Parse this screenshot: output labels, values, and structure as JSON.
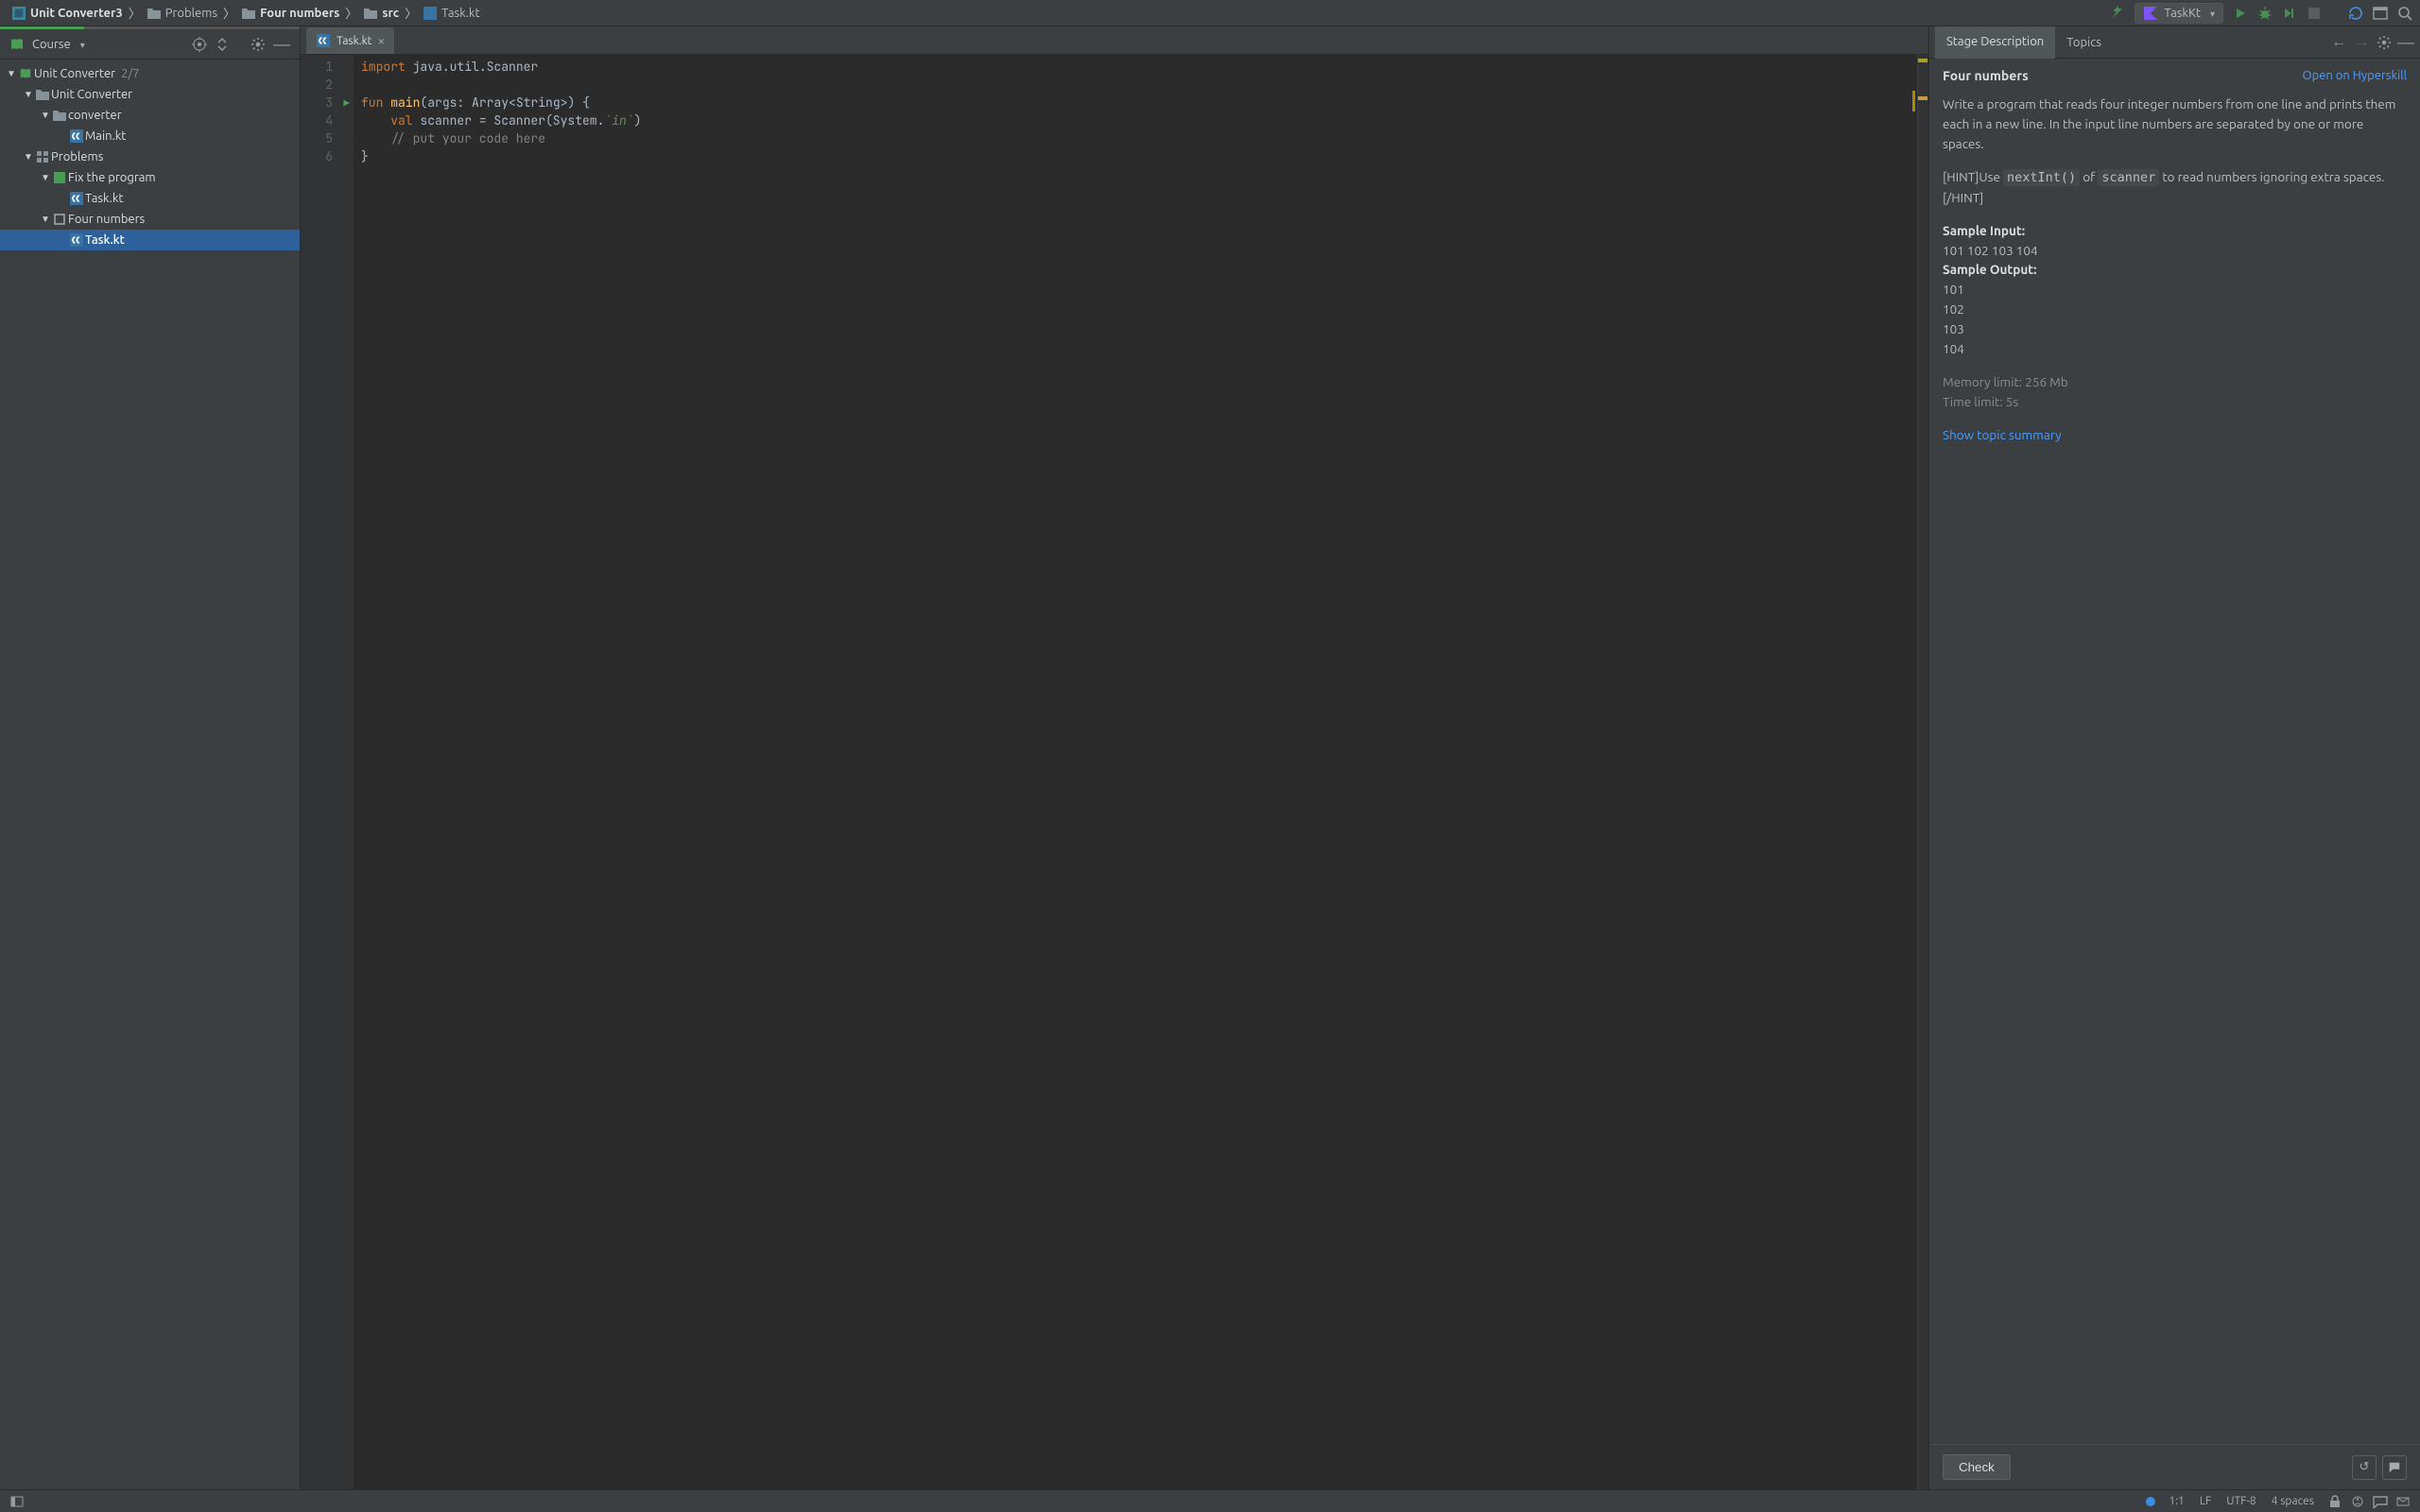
{
  "breadcrumbs": [
    {
      "label": "Unit Converter3",
      "bold": true,
      "icon": "module-icon"
    },
    {
      "label": "Problems",
      "bold": false,
      "icon": "folder-icon"
    },
    {
      "label": "Four numbers",
      "bold": true,
      "icon": "folder-icon"
    },
    {
      "label": "src",
      "bold": true,
      "icon": "folder-icon"
    },
    {
      "label": "Task.kt",
      "bold": false,
      "icon": "kotlin-file-icon"
    }
  ],
  "run_config": {
    "label": "TaskKt"
  },
  "sidepanel": {
    "title": "Course"
  },
  "tree": {
    "root_label": "Unit Converter",
    "root_progress": "2/7",
    "nodes": [
      {
        "depth": 1,
        "icon": "folder-icon",
        "label": "Unit Converter",
        "arrow": true
      },
      {
        "depth": 2,
        "icon": "folder-icon",
        "label": "converter",
        "arrow": true
      },
      {
        "depth": 3,
        "icon": "kotlin-file-icon",
        "label": "Main.kt",
        "arrow": false
      },
      {
        "depth": 1,
        "icon": "grid-icon",
        "label": "Problems",
        "arrow": true
      },
      {
        "depth": 2,
        "icon": "square-done-icon",
        "label": "Fix the program",
        "arrow": true
      },
      {
        "depth": 3,
        "icon": "kotlin-file-icon",
        "label": "Task.kt",
        "arrow": false
      },
      {
        "depth": 2,
        "icon": "square-todo-icon",
        "label": "Four numbers",
        "arrow": true
      },
      {
        "depth": 3,
        "icon": "kotlin-file-icon",
        "label": "Task.kt",
        "arrow": false,
        "selected": true
      }
    ]
  },
  "editor": {
    "tab_label": "Task.kt",
    "lines": [
      "1",
      "2",
      "3",
      "4",
      "5",
      "6"
    ],
    "code": {
      "l1_import": "import",
      "l1_rest": " java.util.Scanner",
      "l3_fun": "fun",
      "l3_main": " main",
      "l3_args": "(args: Array<",
      "l3_string": "String",
      "l3_end": ">) {",
      "l4_val": "    val",
      "l4_rest1": " scanner = Scanner(System.",
      "l4_in": "`in`",
      "l4_rest2": ")",
      "l5_cmt": "    // put your code here",
      "l6": "}"
    }
  },
  "desc": {
    "tabs": {
      "stage": "Stage Description",
      "topics": "Topics"
    },
    "title": "Four numbers",
    "open_link": "Open on Hyperskill",
    "p1": "Write a program that reads four integer numbers from one line and prints them each in a new line. In the input line numbers are separated by one or more spaces.",
    "hint_pre": "[HINT]Use ",
    "hint_code1": "nextInt()",
    "hint_mid": " of ",
    "hint_code2": "scanner",
    "hint_post": " to read numbers ignoring extra spaces.[/HINT]",
    "sample_input_label": "Sample Input:",
    "sample_input": "101 102 103 104",
    "sample_output_label": "Sample Output:",
    "sample_output_lines": [
      "101",
      "102",
      "103",
      "104"
    ],
    "memory": "Memory limit: 256 Mb",
    "time": "Time limit: 5s",
    "topic_link": "Show topic summary",
    "check_label": "Check"
  },
  "status": {
    "pos": "1:1",
    "lf": "LF",
    "enc": "UTF-8",
    "indent": "4 spaces"
  }
}
